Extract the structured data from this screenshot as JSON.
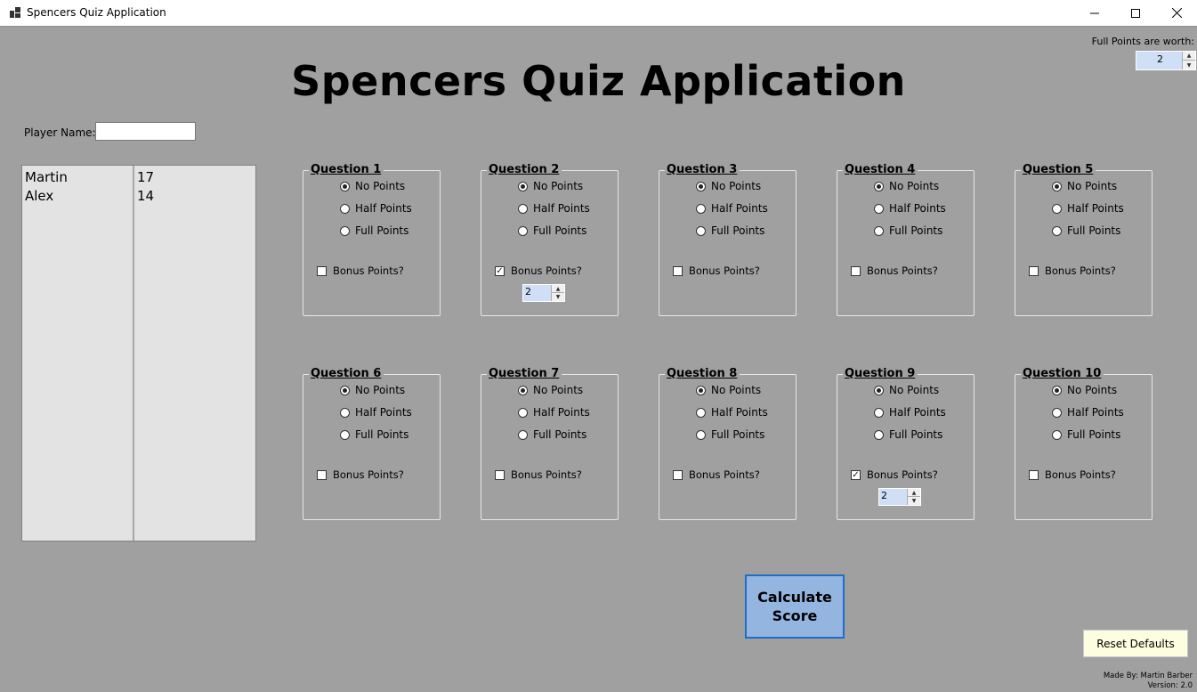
{
  "window": {
    "title": "Spencers Quiz Application",
    "minimize_icon": "minimize-icon",
    "maximize_icon": "maximize-icon",
    "close_icon": "close-icon"
  },
  "header": {
    "title": "Spencers Quiz Application"
  },
  "settings": {
    "full_points_label": "Full Points are worth:",
    "full_points_value": "2"
  },
  "player": {
    "label": "Player Name:",
    "value": ""
  },
  "scoreboard": {
    "names": [
      "Martin",
      "Alex"
    ],
    "scores": [
      "17",
      "14"
    ]
  },
  "questions": [
    {
      "title": "Question 1",
      "selected": "No Points",
      "bonus": false,
      "bonus_value": ""
    },
    {
      "title": "Question 2",
      "selected": "No Points",
      "bonus": true,
      "bonus_value": "2"
    },
    {
      "title": "Question 3",
      "selected": "No Points",
      "bonus": false,
      "bonus_value": ""
    },
    {
      "title": "Question 4",
      "selected": "No Points",
      "bonus": false,
      "bonus_value": ""
    },
    {
      "title": "Question 5",
      "selected": "No Points",
      "bonus": false,
      "bonus_value": ""
    },
    {
      "title": "Question 6",
      "selected": "No Points",
      "bonus": false,
      "bonus_value": ""
    },
    {
      "title": "Question 7",
      "selected": "No Points",
      "bonus": false,
      "bonus_value": ""
    },
    {
      "title": "Question 8",
      "selected": "No Points",
      "bonus": false,
      "bonus_value": ""
    },
    {
      "title": "Question 9",
      "selected": "No Points",
      "bonus": true,
      "bonus_value": "2"
    },
    {
      "title": "Question 10",
      "selected": "No Points",
      "bonus": false,
      "bonus_value": ""
    }
  ],
  "question_options": [
    "No Points",
    "Half Points",
    "Full Points"
  ],
  "bonus_label": "Bonus Points?",
  "actions": {
    "calculate_label": "Calculate\nScore",
    "reset_label": "Reset Defaults"
  },
  "credits": {
    "made_by": "Made By: Martin Barber",
    "version": "Version: 2.0"
  },
  "colors": {
    "background": "#a0a0a0",
    "calculate_button": "#93b5e0",
    "reset_button": "#fdfde0",
    "scoreboard": "#e3e3e3"
  }
}
